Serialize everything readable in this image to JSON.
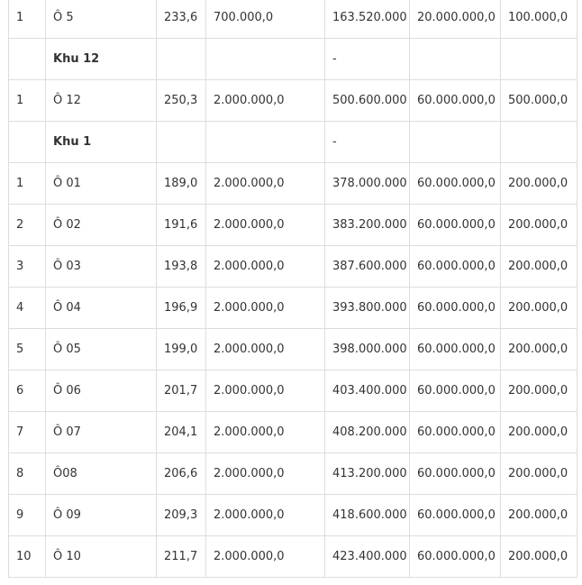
{
  "rows": [
    {
      "type": "item",
      "stt": "1",
      "name": "Ô 5",
      "area": "233,6",
      "price": "700.000,0",
      "total": "163.520.000",
      "deposit": "20.000.000,0",
      "fee": "100.000,0"
    },
    {
      "type": "group",
      "stt": "",
      "name": "Khu 12",
      "area": "",
      "price": "",
      "total": "-",
      "deposit": "",
      "fee": ""
    },
    {
      "type": "item",
      "stt": "1",
      "name": "Ô 12",
      "area": "250,3",
      "price": "2.000.000,0",
      "total": "500.600.000",
      "deposit": "60.000.000,0",
      "fee": "500.000,0"
    },
    {
      "type": "group",
      "stt": "",
      "name": "Khu 1",
      "area": "",
      "price": "",
      "total": "-",
      "deposit": "",
      "fee": ""
    },
    {
      "type": "item",
      "stt": "1",
      "name": "Ô 01",
      "area": "189,0",
      "price": "2.000.000,0",
      "total": "378.000.000",
      "deposit": "60.000.000,0",
      "fee": "200.000,0"
    },
    {
      "type": "item",
      "stt": "2",
      "name": "Ô 02",
      "area": "191,6",
      "price": "2.000.000,0",
      "total": "383.200.000",
      "deposit": "60.000.000,0",
      "fee": "200.000,0"
    },
    {
      "type": "item",
      "stt": "3",
      "name": "Ô 03",
      "area": "193,8",
      "price": "2.000.000,0",
      "total": "387.600.000",
      "deposit": "60.000.000,0",
      "fee": "200.000,0"
    },
    {
      "type": "item",
      "stt": "4",
      "name": "Ô 04",
      "area": "196,9",
      "price": "2.000.000,0",
      "total": "393.800.000",
      "deposit": "60.000.000,0",
      "fee": "200.000,0"
    },
    {
      "type": "item",
      "stt": "5",
      "name": "Ô 05",
      "area": "199,0",
      "price": "2.000.000,0",
      "total": "398.000.000",
      "deposit": "60.000.000,0",
      "fee": "200.000,0"
    },
    {
      "type": "item",
      "stt": "6",
      "name": "Ô 06",
      "area": "201,7",
      "price": "2.000.000,0",
      "total": "403.400.000",
      "deposit": "60.000.000,0",
      "fee": "200.000,0"
    },
    {
      "type": "item",
      "stt": "7",
      "name": "Ô 07",
      "area": "204,1",
      "price": "2.000.000,0",
      "total": "408.200.000",
      "deposit": "60.000.000,0",
      "fee": "200.000,0"
    },
    {
      "type": "item",
      "stt": "8",
      "name": "Ô08",
      "area": "206,6",
      "price": "2.000.000,0",
      "total": "413.200.000",
      "deposit": "60.000.000,0",
      "fee": "200.000,0"
    },
    {
      "type": "item",
      "stt": "9",
      "name": "Ô 09",
      "area": "209,3",
      "price": "2.000.000,0",
      "total": "418.600.000",
      "deposit": "60.000.000,0",
      "fee": "200.000,0"
    },
    {
      "type": "item",
      "stt": "10",
      "name": "Ô 10",
      "area": "211,7",
      "price": "2.000.000,0",
      "total": "423.400.000",
      "deposit": "60.000.000,0",
      "fee": "200.000,0"
    }
  ]
}
